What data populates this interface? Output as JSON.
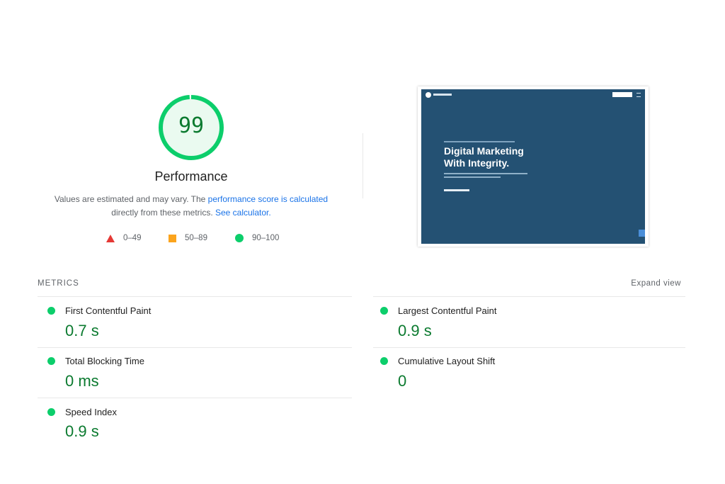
{
  "score": {
    "value": 99,
    "label": "Performance",
    "ring_color": "#0cce6b",
    "value_color": "#0b7a2f"
  },
  "description": {
    "text1": "Values are estimated and may vary. The ",
    "link1": "performance score is calculated",
    "text2": "directly from these metrics. ",
    "link2": "See calculator."
  },
  "legend": [
    {
      "icon": "triangle-icon",
      "range": "0–49",
      "color": "#e53935"
    },
    {
      "icon": "square-icon",
      "range": "50–89",
      "color": "#fba41d"
    },
    {
      "icon": "circle-icon",
      "range": "90–100",
      "color": "#0cce6b"
    }
  ],
  "screenshot": {
    "headline_line1": "Digital Marketing",
    "headline_line2": "With Integrity.",
    "background": "#245173"
  },
  "metrics": {
    "heading": "METRICS",
    "expand_label": "Expand view",
    "items": [
      {
        "name": "First Contentful Paint",
        "value": "0.7 s",
        "status_color": "#0cce6b"
      },
      {
        "name": "Largest Contentful Paint",
        "value": "0.9 s",
        "status_color": "#0cce6b"
      },
      {
        "name": "Total Blocking Time",
        "value": "0 ms",
        "status_color": "#0cce6b"
      },
      {
        "name": "Cumulative Layout Shift",
        "value": "0",
        "status_color": "#0cce6b"
      },
      {
        "name": "Speed Index",
        "value": "0.9 s",
        "status_color": "#0cce6b"
      }
    ]
  }
}
